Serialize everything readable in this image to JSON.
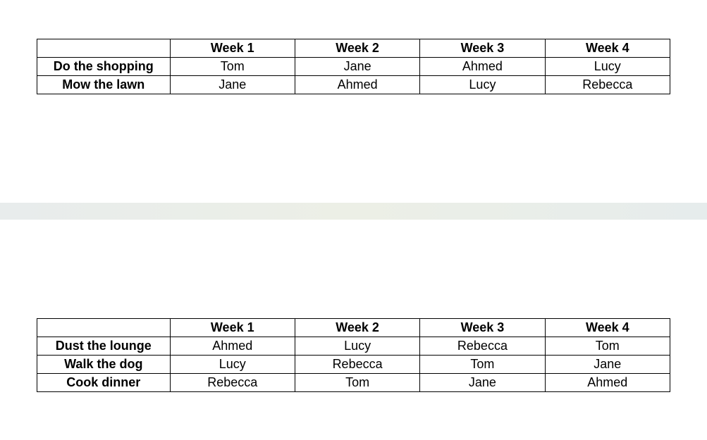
{
  "chart_data": [
    {
      "type": "table",
      "columns": [
        "",
        "Week 1",
        "Week 2",
        "Week 3",
        "Week 4"
      ],
      "rows": [
        {
          "task": "Do the shopping",
          "values": [
            "Tom",
            "Jane",
            "Ahmed",
            "Lucy"
          ]
        },
        {
          "task": "Mow the lawn",
          "values": [
            "Jane",
            "Ahmed",
            "Lucy",
            "Rebecca"
          ]
        }
      ]
    },
    {
      "type": "table",
      "columns": [
        "",
        "Week 1",
        "Week 2",
        "Week 3",
        "Week 4"
      ],
      "rows": [
        {
          "task": "Dust the lounge",
          "values": [
            "Ahmed",
            "Lucy",
            "Rebecca",
            "Tom"
          ]
        },
        {
          "task": "Walk the dog",
          "values": [
            "Lucy",
            "Rebecca",
            "Tom",
            "Jane"
          ]
        },
        {
          "task": "Cook dinner",
          "values": [
            "Rebecca",
            "Tom",
            "Jane",
            "Ahmed"
          ]
        }
      ]
    }
  ],
  "table1": {
    "headers": {
      "blank": "",
      "w1": "Week 1",
      "w2": "Week 2",
      "w3": "Week 3",
      "w4": "Week 4"
    },
    "row0": {
      "task": "Do the shopping",
      "c1": "Tom",
      "c2": "Jane",
      "c3": "Ahmed",
      "c4": "Lucy"
    },
    "row1": {
      "task": "Mow the lawn",
      "c1": "Jane",
      "c2": "Ahmed",
      "c3": "Lucy",
      "c4": "Rebecca"
    }
  },
  "table2": {
    "headers": {
      "blank": "",
      "w1": "Week 1",
      "w2": "Week 2",
      "w3": "Week 3",
      "w4": "Week 4"
    },
    "row0": {
      "task": "Dust the lounge",
      "c1": "Ahmed",
      "c2": "Lucy",
      "c3": "Rebecca",
      "c4": "Tom"
    },
    "row1": {
      "task": "Walk the dog",
      "c1": "Lucy",
      "c2": "Rebecca",
      "c3": "Tom",
      "c4": "Jane"
    },
    "row2": {
      "task": "Cook dinner",
      "c1": "Rebecca",
      "c2": "Tom",
      "c3": "Jane",
      "c4": "Ahmed"
    }
  }
}
